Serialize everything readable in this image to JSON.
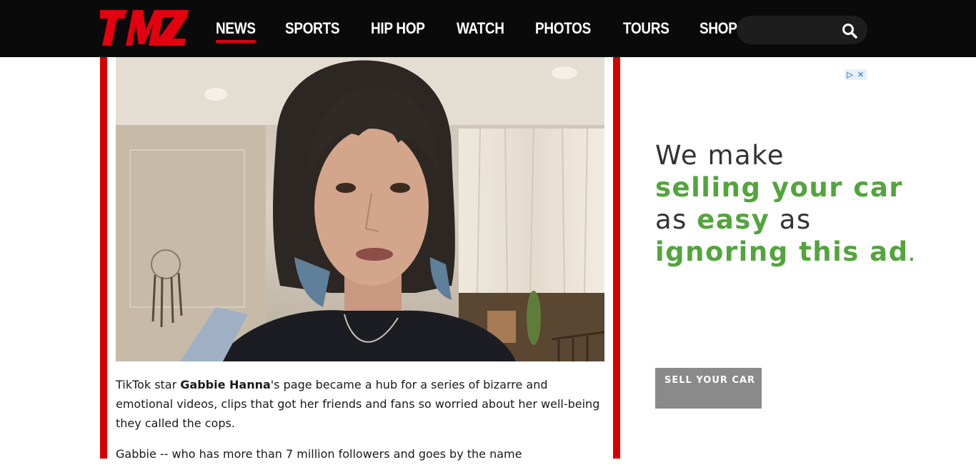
{
  "header": {
    "logo_text": "TMZ",
    "nav": [
      {
        "label": "NEWS",
        "active": true
      },
      {
        "label": "SPORTS",
        "active": false
      },
      {
        "label": "HIP HOP",
        "active": false
      },
      {
        "label": "WATCH",
        "active": false
      },
      {
        "label": "PHOTOS",
        "active": false
      },
      {
        "label": "TOURS",
        "active": false
      },
      {
        "label": "SHOP",
        "active": false
      }
    ],
    "search": {
      "placeholder": "",
      "icon": "search-icon"
    }
  },
  "article": {
    "hero_image": "woman-with-bangs-and-blue-tipped-hair-video-still",
    "p1_prefix": "TikTok star ",
    "p1_name": "Gabbie Hanna",
    "p1_suffix": "'s page became a hub for a series of bizarre and emotional videos, clips that got her friends and fans so worried about her well-being they called the cops.",
    "p2": "Gabbie -- who has more than 7 million followers and goes by the name"
  },
  "ad": {
    "line1": "We make",
    "line2": "selling your car",
    "line3_a": "as ",
    "line3_b": "easy",
    "line3_c": " as",
    "line4": "ignoring this ad",
    "line4_dot": ".",
    "cta": "SELL YOUR CAR",
    "choices_icon": "adchoices-icon",
    "close_icon": "close-icon"
  },
  "colors": {
    "brand_red": "#e3000f",
    "border_red": "#d60000",
    "ad_green": "#53a43d",
    "header_bg": "#0a0a0a"
  }
}
